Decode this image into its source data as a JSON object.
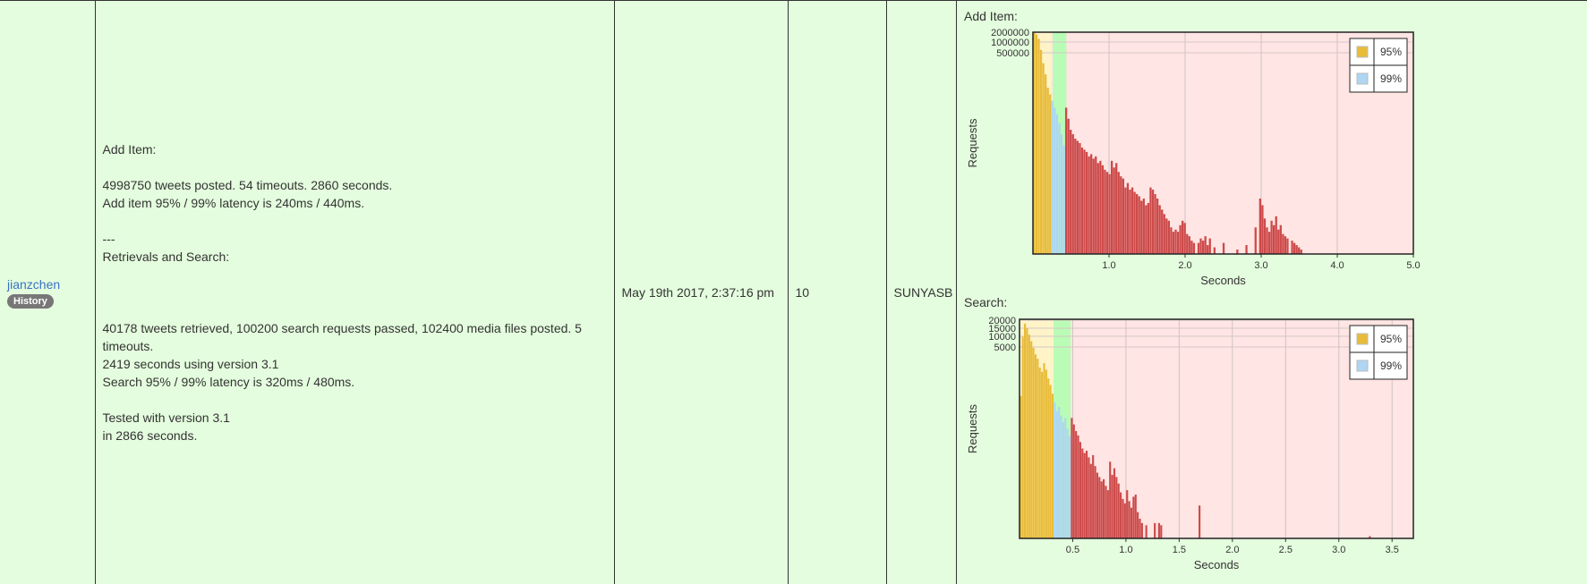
{
  "user": {
    "name": "jianzchen",
    "history_label": "History"
  },
  "details": {
    "add_heading": "Add Item:",
    "add_line1": "4998750 tweets posted. 54 timeouts. 2860 seconds.",
    "add_line2": "Add item 95% / 99% latency is 240ms / 440ms.",
    "separator": "---",
    "search_heading": "Retrievals and Search:",
    "search_line1": "40178 tweets retrieved, 100200 search requests passed, 102400 media files posted. 5 timeouts.",
    "search_line2": "2419 seconds using version 3.1",
    "search_line3": "Search 95% / 99% latency is 320ms / 480ms.",
    "tested_line1": "Tested with version 3.1",
    "tested_line2": "in 2866 seconds."
  },
  "date": "May 19th 2017, 2:37:16 pm",
  "count": "10",
  "team": "SUNYASB",
  "colors": {
    "p95": "#e8bc3a",
    "p99": "#aed6f3",
    "band": "#b9fcb6",
    "tail": "#cd4a4a",
    "plot_bg": "#ffe5e3"
  },
  "charts": [
    {
      "title": "Add Item:",
      "ylabel": "Requests",
      "xlabel": "Seconds",
      "xlim": [
        0,
        5.0
      ],
      "xticks": [
        "1.0",
        "2.0",
        "3.0",
        "4.0",
        "5.0"
      ],
      "yticks": [
        "2000000",
        "1000000",
        "500000"
      ],
      "legend": [
        "95%",
        "99%"
      ],
      "p95": 0.24,
      "p99": 0.44,
      "green_band": [
        0.26,
        0.44
      ],
      "bins": [
        [
          0.03,
          1.0
        ],
        [
          0.06,
          0.99
        ],
        [
          0.09,
          0.97
        ],
        [
          0.12,
          0.92
        ],
        [
          0.15,
          0.86
        ],
        [
          0.18,
          0.81
        ],
        [
          0.21,
          0.75
        ],
        [
          0.24,
          0.72
        ],
        [
          0.27,
          0.69
        ],
        [
          0.3,
          0.66
        ],
        [
          0.33,
          0.63
        ],
        [
          0.36,
          0.59
        ],
        [
          0.39,
          0.54
        ],
        [
          0.42,
          0.49
        ],
        [
          0.45,
          0.66
        ],
        [
          0.48,
          0.61
        ],
        [
          0.51,
          0.56
        ],
        [
          0.54,
          0.54
        ],
        [
          0.57,
          0.52
        ],
        [
          0.6,
          0.51
        ],
        [
          0.63,
          0.5
        ],
        [
          0.66,
          0.48
        ],
        [
          0.69,
          0.47
        ],
        [
          0.72,
          0.46
        ],
        [
          0.75,
          0.44
        ],
        [
          0.78,
          0.45
        ],
        [
          0.81,
          0.43
        ],
        [
          0.84,
          0.44
        ],
        [
          0.87,
          0.41
        ],
        [
          0.9,
          0.42
        ],
        [
          0.93,
          0.4
        ],
        [
          0.96,
          0.38
        ],
        [
          0.99,
          0.37
        ],
        [
          1.02,
          0.36
        ],
        [
          1.05,
          0.42
        ],
        [
          1.08,
          0.39
        ],
        [
          1.11,
          0.41
        ],
        [
          1.14,
          0.37
        ],
        [
          1.17,
          0.35
        ],
        [
          1.2,
          0.34
        ],
        [
          1.23,
          0.3
        ],
        [
          1.26,
          0.32
        ],
        [
          1.29,
          0.29
        ],
        [
          1.32,
          0.3
        ],
        [
          1.35,
          0.28
        ],
        [
          1.38,
          0.27
        ],
        [
          1.41,
          0.26
        ],
        [
          1.44,
          0.24
        ],
        [
          1.47,
          0.25
        ],
        [
          1.5,
          0.22
        ],
        [
          1.53,
          0.23
        ],
        [
          1.56,
          0.3
        ],
        [
          1.59,
          0.29
        ],
        [
          1.62,
          0.27
        ],
        [
          1.65,
          0.25
        ],
        [
          1.68,
          0.22
        ],
        [
          1.71,
          0.2
        ],
        [
          1.74,
          0.18
        ],
        [
          1.77,
          0.16
        ],
        [
          1.8,
          0.15
        ],
        [
          1.83,
          0.12
        ],
        [
          1.86,
          0.1
        ],
        [
          1.89,
          0.11
        ],
        [
          1.92,
          0.1
        ],
        [
          1.95,
          0.13
        ],
        [
          1.98,
          0.15
        ],
        [
          2.01,
          0.14
        ],
        [
          2.04,
          0.09
        ],
        [
          2.07,
          0.08
        ],
        [
          2.1,
          0.06
        ],
        [
          2.13,
          0.05
        ],
        [
          2.19,
          0.05
        ],
        [
          2.22,
          0.07
        ],
        [
          2.25,
          0.06
        ],
        [
          2.28,
          0.08
        ],
        [
          2.31,
          0.04
        ],
        [
          2.34,
          0.07
        ],
        [
          2.4,
          0.03
        ],
        [
          2.52,
          0.05
        ],
        [
          2.7,
          0.02
        ],
        [
          2.82,
          0.04
        ],
        [
          2.94,
          0.12
        ],
        [
          3.0,
          0.25
        ],
        [
          3.03,
          0.22
        ],
        [
          3.06,
          0.16
        ],
        [
          3.09,
          0.12
        ],
        [
          3.12,
          0.1
        ],
        [
          3.15,
          0.15
        ],
        [
          3.18,
          0.13
        ],
        [
          3.21,
          0.17
        ],
        [
          3.24,
          0.11
        ],
        [
          3.27,
          0.13
        ],
        [
          3.3,
          0.09
        ],
        [
          3.33,
          0.08
        ],
        [
          3.36,
          0.07
        ],
        [
          3.42,
          0.06
        ],
        [
          3.45,
          0.05
        ],
        [
          3.48,
          0.04
        ],
        [
          3.51,
          0.03
        ],
        [
          3.54,
          0.02
        ]
      ]
    },
    {
      "title": "Search:",
      "ylabel": "Requests",
      "xlabel": "Seconds",
      "xlim": [
        0,
        3.7
      ],
      "xticks": [
        "0.5",
        "1.0",
        "1.5",
        "2.0",
        "2.5",
        "3.0",
        "3.5"
      ],
      "yticks": [
        "20000",
        "15000",
        "10000",
        "5000"
      ],
      "legend": [
        "95%",
        "99%"
      ],
      "p95": 0.32,
      "p99": 0.48,
      "green_band": [
        0.32,
        0.48
      ],
      "bins": [
        [
          0.02,
          0.65
        ],
        [
          0.04,
          0.92
        ],
        [
          0.06,
          0.98
        ],
        [
          0.08,
          0.96
        ],
        [
          0.1,
          0.93
        ],
        [
          0.12,
          0.9
        ],
        [
          0.14,
          0.87
        ],
        [
          0.16,
          0.84
        ],
        [
          0.18,
          0.82
        ],
        [
          0.2,
          0.78
        ],
        [
          0.22,
          0.76
        ],
        [
          0.24,
          0.8
        ],
        [
          0.26,
          0.77
        ],
        [
          0.28,
          0.73
        ],
        [
          0.3,
          0.7
        ],
        [
          0.32,
          0.66
        ],
        [
          0.34,
          0.62
        ],
        [
          0.36,
          0.58
        ],
        [
          0.38,
          0.6
        ],
        [
          0.4,
          0.56
        ],
        [
          0.42,
          0.53
        ],
        [
          0.44,
          0.55
        ],
        [
          0.46,
          0.5
        ],
        [
          0.48,
          0.47
        ],
        [
          0.5,
          0.55
        ],
        [
          0.52,
          0.52
        ],
        [
          0.54,
          0.49
        ],
        [
          0.56,
          0.47
        ],
        [
          0.58,
          0.44
        ],
        [
          0.6,
          0.41
        ],
        [
          0.62,
          0.39
        ],
        [
          0.64,
          0.4
        ],
        [
          0.66,
          0.37
        ],
        [
          0.68,
          0.34
        ],
        [
          0.7,
          0.38
        ],
        [
          0.72,
          0.33
        ],
        [
          0.74,
          0.3
        ],
        [
          0.76,
          0.28
        ],
        [
          0.78,
          0.26
        ],
        [
          0.8,
          0.27
        ],
        [
          0.82,
          0.24
        ],
        [
          0.84,
          0.22
        ],
        [
          0.86,
          0.35
        ],
        [
          0.88,
          0.29
        ],
        [
          0.9,
          0.32
        ],
        [
          0.92,
          0.28
        ],
        [
          0.94,
          0.25
        ],
        [
          0.96,
          0.21
        ],
        [
          0.98,
          0.18
        ],
        [
          1.0,
          0.16
        ],
        [
          1.02,
          0.22
        ],
        [
          1.04,
          0.17
        ],
        [
          1.06,
          0.14
        ],
        [
          1.08,
          0.19
        ],
        [
          1.1,
          0.2
        ],
        [
          1.12,
          0.12
        ],
        [
          1.14,
          0.09
        ],
        [
          1.16,
          0.07
        ],
        [
          1.2,
          0.06
        ],
        [
          1.28,
          0.07
        ],
        [
          1.32,
          0.07
        ],
        [
          1.34,
          0.06
        ],
        [
          1.7,
          0.15
        ],
        [
          3.3,
          0.01
        ]
      ]
    }
  ]
}
